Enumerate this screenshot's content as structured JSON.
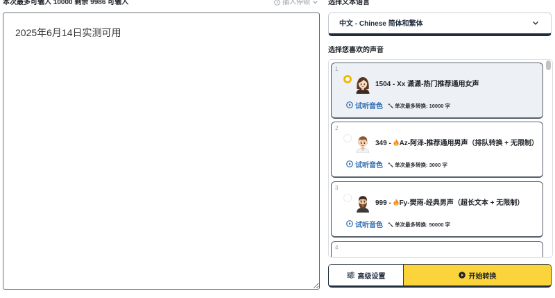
{
  "editor": {
    "limit_text": "本次最多可输入 10000 剩余 9986 可输入",
    "insert_pause_label": "插入停顿",
    "text": "2025年6月14日实测可用"
  },
  "language": {
    "section_title": "选择文本语言",
    "selected_value": "中文 - Chinese 简体和繁体"
  },
  "voices": {
    "section_title": "选择您喜欢的声音",
    "preview_label": "试听音色",
    "items": [
      {
        "index": "1",
        "title_prefix": "1504 - ",
        "hot": false,
        "name": "Xx 潇潇-热门推荐通用女声",
        "limit": "单次最多转换: 10000 字",
        "selected": true,
        "avatar_icon": "woman-avatar-icon"
      },
      {
        "index": "2",
        "title_prefix": "349 - ",
        "hot": true,
        "name": "Az-阿泽-推荐通用男声（排队转换 + 无限制）",
        "limit": "单次最多转换: 3000 字",
        "selected": false,
        "avatar_icon": "man-avatar-icon"
      },
      {
        "index": "3",
        "title_prefix": "999 - ",
        "hot": true,
        "name": "Fy-樊雨-经典男声（超长文本 + 无限制）",
        "limit": "单次最多转换: 50000 字",
        "selected": false,
        "avatar_icon": "bearded-man-avatar-icon"
      },
      {
        "index": "4"
      }
    ]
  },
  "actions": {
    "advanced_label": "高级设置",
    "start_label": "开始转换"
  },
  "icons": {
    "insert_pause": "clock-icon",
    "language_dropdown": "chevron-down-icon",
    "preview": "play-circle-icon",
    "limit": "convert-icon",
    "hot": "flame-icon",
    "advanced": "sliders-icon",
    "start": "play-filled-icon"
  },
  "theme": {
    "accent": "#fbd43b",
    "navy": "#1f2d3d",
    "link": "#2c6cb0",
    "selected-bg": "#edf0f4",
    "radio-selected": "#f3b900"
  }
}
